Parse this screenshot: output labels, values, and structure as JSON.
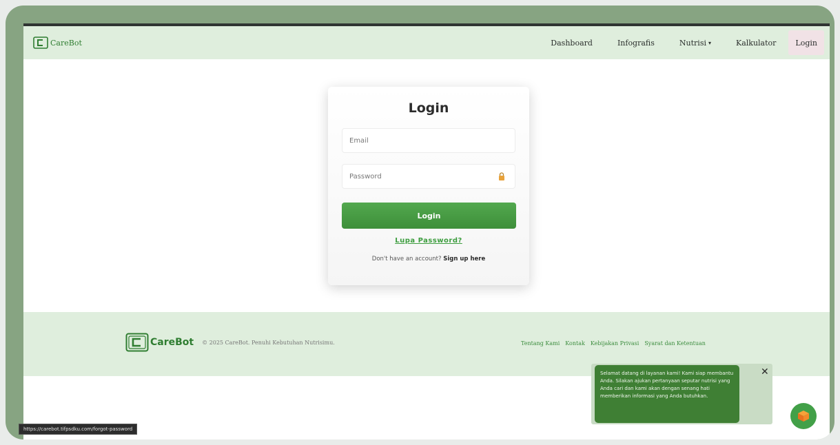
{
  "app": {
    "brand_name": "CareBot"
  },
  "nav": {
    "items": [
      {
        "label": "Dashboard"
      },
      {
        "label": "Infografis"
      },
      {
        "label": "Nutrisi",
        "caret": "▾"
      },
      {
        "label": "Kalkulator"
      },
      {
        "label": "Login",
        "active": true
      }
    ]
  },
  "login": {
    "title": "Login",
    "email_placeholder": "Email",
    "password_placeholder": "Password",
    "button_label": "Login",
    "forgot_label": "Lupa Password?",
    "signup_prompt": "Don't have an account?",
    "signup_link": "Sign up here"
  },
  "footer": {
    "brand_name": "CareBot",
    "copyright": "© 2025 CareBot. Penuhi Kebutuhan Nutrisimu.",
    "links": [
      "Tentang Kami",
      "Kontak",
      "Kebijakan Privasi",
      "Syarat dan Ketentuan"
    ]
  },
  "chat": {
    "message": "Selamat datang di layanan kami! Kami siap membantu Anda. Silakan ajukan pertanyaan seputar nutrisi yang Anda cari dan kami akan dengan senang hati memberikan informasi yang Anda butuhkan.",
    "close_symbol": "✕"
  },
  "status_bar": {
    "url": "https://carebot.tifpsdku.com/forgot-password"
  },
  "colors": {
    "accent": "#3f8f3a",
    "nav_bg": "#dfeedd",
    "frame": "#87a482"
  },
  "icons": [
    "carebot-logo-icon",
    "lock-icon",
    "close-icon",
    "cube-icon"
  ]
}
